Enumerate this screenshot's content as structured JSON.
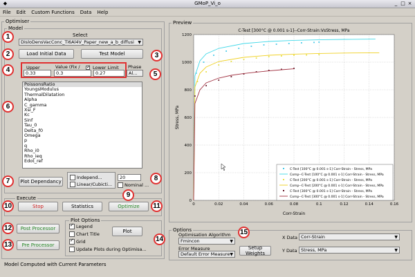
{
  "window": {
    "title": "GMoP_Vi_o",
    "controls": [
      "_",
      "□",
      "×"
    ]
  },
  "menu": [
    "File",
    "Edit",
    "Custom Functions",
    "Data",
    "Help"
  ],
  "optimiser": {
    "label": "Optimiser",
    "model": {
      "label": "Model",
      "select_label": "Select",
      "select_value": "DisloDensVacConc_Ti6Al4V_Paper_new_a_b_diffusi",
      "load_button": "Load Initial Data",
      "test_button": "Test Model",
      "upper_label": "Upper",
      "value_label": "Value (Fix /",
      "lower_label": "Lower Limit",
      "upper_value": "0.33",
      "value_value": "0.3",
      "lower_value": "0.27",
      "phase_label": "Phase",
      "phase_value": "Al...",
      "params": [
        "PoissonsRatio",
        "YoungsModulus",
        "ThermalDilatation",
        "Alpha",
        "C_gamma",
        "Xsi_F",
        "Kc",
        "Sinf",
        "Tau_0",
        "Delta_f0",
        "Omega",
        "p",
        "q",
        "Rho_i0",
        "Rho_ieq",
        "Edot_ref"
      ],
      "plot_dependency": "Plot Dependancy",
      "independent_label": "Independ...",
      "linear_label": "Linear/Cubicti...",
      "points_value": "20",
      "nominal_label": "Nominal ..."
    },
    "execute": {
      "label": "Execute",
      "stop": "Stop",
      "statistics": "Statistics",
      "optimize": "Optimize"
    },
    "post_processor": "Post Processor",
    "pre_processor": "Pre Processor",
    "plot_options": {
      "label": "Plot Options",
      "legend": "Legend",
      "chart_title": "Chart Title",
      "grid": "Grid",
      "update_plots": "Update Plots during Optimisa...",
      "plot_button": "Plot"
    },
    "status": "Model Computed with Current Parameters"
  },
  "preview": {
    "label": "Preview",
    "chart_data": {
      "type": "scatter",
      "title": "C-Test [300°C @ 0.001 s-1]--Corr-Strain:VsStress, MPa",
      "xlabel": "Corr-Strain",
      "ylabel": "Stress, MPa",
      "xlim": [
        0,
        0.16
      ],
      "ylim": [
        0,
        1200
      ],
      "xticks": [
        "0",
        "0.02",
        "0.04",
        "0.06",
        "0.08",
        "0.1",
        "0.12",
        "0.14",
        "0.16"
      ],
      "yticks": [
        "0",
        "200",
        "400",
        "600",
        "800",
        "1000",
        "1200"
      ],
      "grid": true,
      "legend_position": "bottom-right",
      "series": [
        {
          "name": "C-Test [100°C @ 0.001 s-1] Corr-Strain - Stress, MPa",
          "kind": "points",
          "color": "#40c8e8",
          "points": [
            [
              0.002,
              920
            ],
            [
              0.008,
              1000
            ],
            [
              0.016,
              1050
            ],
            [
              0.026,
              1080
            ],
            [
              0.036,
              1100
            ],
            [
              0.046,
              1115
            ],
            [
              0.056,
              1125
            ],
            [
              0.066,
              1130
            ],
            [
              0.076,
              1135
            ],
            [
              0.086,
              1140
            ],
            [
              0.096,
              1143
            ],
            [
              0.1,
              1145
            ]
          ]
        },
        {
          "name": "Comp--C-Test [100°C @ 0.001 s-1] Corr-Strain - Stress, MPa",
          "kind": "line",
          "color": "#40d8e8",
          "points": [
            [
              0.0,
              0
            ],
            [
              0.001,
              900
            ],
            [
              0.005,
              1010
            ],
            [
              0.01,
              1060
            ],
            [
              0.02,
              1100
            ],
            [
              0.04,
              1135
            ],
            [
              0.06,
              1150
            ],
            [
              0.08,
              1158
            ],
            [
              0.1,
              1162
            ],
            [
              0.12,
              1165
            ],
            [
              0.145,
              1167
            ]
          ]
        },
        {
          "name": "C-Test [200°C @ 0.001 s-1] Corr-Strain - Stress, MPa",
          "kind": "points",
          "color": "#e8e040",
          "points": [
            [
              0.003,
              860
            ],
            [
              0.01,
              930
            ],
            [
              0.02,
              980
            ],
            [
              0.03,
              1005
            ],
            [
              0.04,
              1020
            ],
            [
              0.05,
              1030
            ],
            [
              0.06,
              1040
            ],
            [
              0.07,
              1045
            ],
            [
              0.08,
              1050
            ],
            [
              0.09,
              1052
            ],
            [
              0.1,
              1055
            ]
          ]
        },
        {
          "name": "Comp--C-Test [200°C @ 0.001 s-1] Corr-Strain - Stress, MPa",
          "kind": "line",
          "color": "#f0d020",
          "points": [
            [
              0.0,
              0
            ],
            [
              0.001,
              820
            ],
            [
              0.005,
              920
            ],
            [
              0.01,
              965
            ],
            [
              0.02,
              1005
            ],
            [
              0.04,
              1035
            ],
            [
              0.06,
              1050
            ],
            [
              0.08,
              1058
            ],
            [
              0.1,
              1063
            ],
            [
              0.12,
              1066
            ],
            [
              0.148,
              1068
            ]
          ]
        },
        {
          "name": "C-Test [300°C @ 0.001 s-1] Corr-Strain - Stress, MPa",
          "kind": "points",
          "color": "#601020",
          "points": [
            [
              0.001,
              755
            ],
            [
              0.01,
              830
            ],
            [
              0.02,
              870
            ],
            [
              0.03,
              895
            ],
            [
              0.04,
              915
            ],
            [
              0.05,
              930
            ],
            [
              0.06,
              940
            ],
            [
              0.07,
              948
            ],
            [
              0.08,
              955
            ]
          ]
        },
        {
          "name": "Comp--C-Test [300°C @ 0.001 s-1] Corr-Strain - Stress, MPa",
          "kind": "line",
          "color": "#a03040",
          "points": [
            [
              0.0,
              0
            ],
            [
              0.001,
              700
            ],
            [
              0.005,
              800
            ],
            [
              0.01,
              850
            ],
            [
              0.02,
              885
            ],
            [
              0.03,
              905
            ],
            [
              0.04,
              918
            ],
            [
              0.05,
              928
            ],
            [
              0.06,
              937
            ],
            [
              0.07,
              945
            ],
            [
              0.08,
              952
            ]
          ]
        }
      ]
    }
  },
  "options": {
    "label": "Options",
    "algorithm_label": "Optimisation Algorithm",
    "algorithm_value": "Fmincon",
    "error_label": "Error Measure",
    "error_value": "Default Error Measure",
    "setup_weights": "Setup Weights",
    "xdata_label": "X Data",
    "xdata_value": "Corr-Strain",
    "ydata_label": "Y Data",
    "ydata_value": "Stress, MPa"
  },
  "callouts": [
    "1",
    "2",
    "3",
    "4",
    "5",
    "6",
    "7",
    "8",
    "9",
    "10",
    "11",
    "12",
    "13",
    "14",
    "15"
  ],
  "colors": {
    "callout": "#e03030",
    "green_text": "#2a8a2a",
    "red_text": "#d02020"
  }
}
